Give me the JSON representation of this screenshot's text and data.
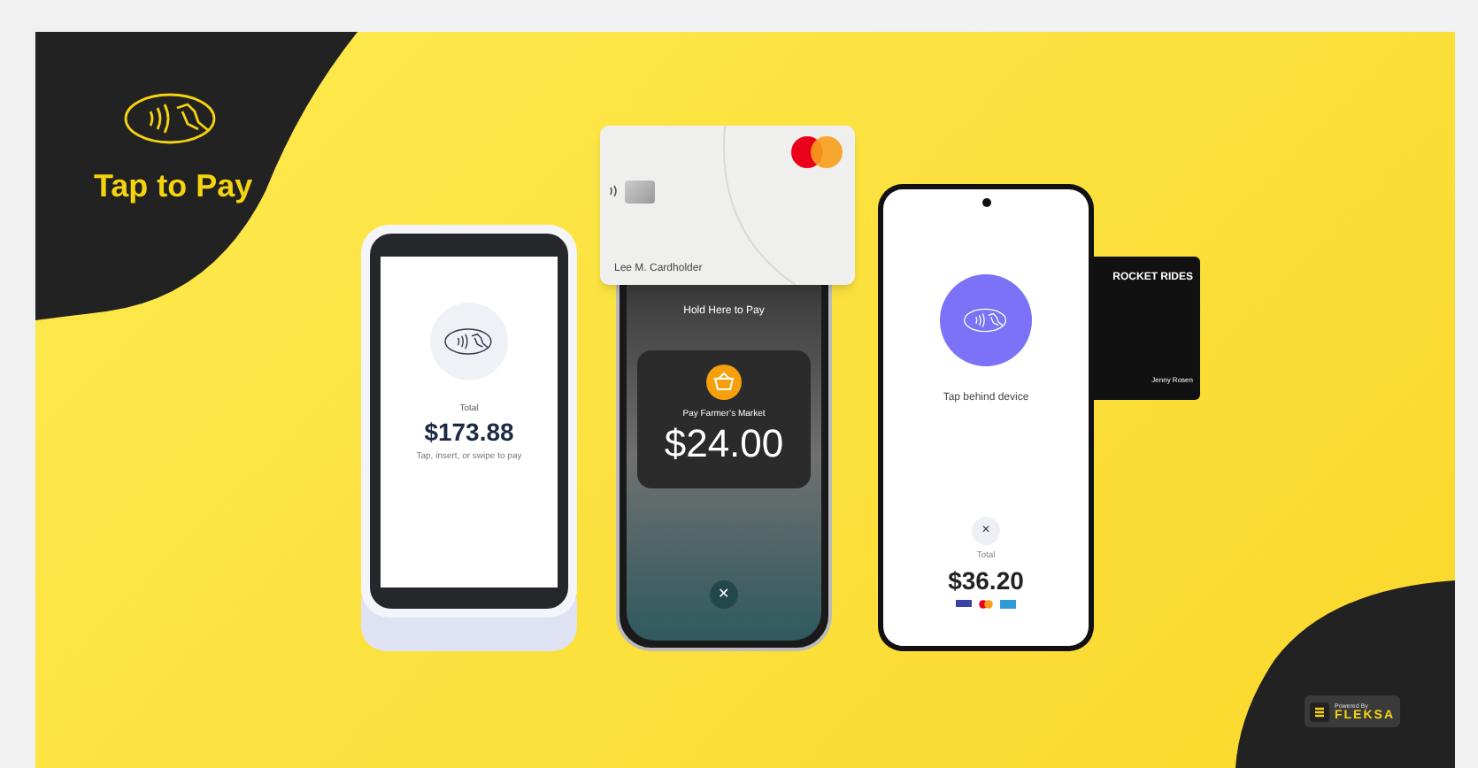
{
  "brand": {
    "title": "Tap to Pay"
  },
  "terminal": {
    "label": "Total",
    "amount": "$173.88",
    "hint": "Tap, insert, or swipe to pay"
  },
  "card": {
    "holder": "Lee M. Cardholder"
  },
  "iphone": {
    "prompt": "Hold Here to Pay",
    "merchant": "Pay Farmer’s Market",
    "amount": "$24.00",
    "close": "✕"
  },
  "android": {
    "prompt": "Tap behind device",
    "close": "✕",
    "label": "Total",
    "amount": "$36.20"
  },
  "black_card": {
    "brand": "ROCKET RIDES",
    "holder": "Jenny Rosen"
  },
  "badge": {
    "caption": "Powered By",
    "name": "FLEKSA"
  }
}
